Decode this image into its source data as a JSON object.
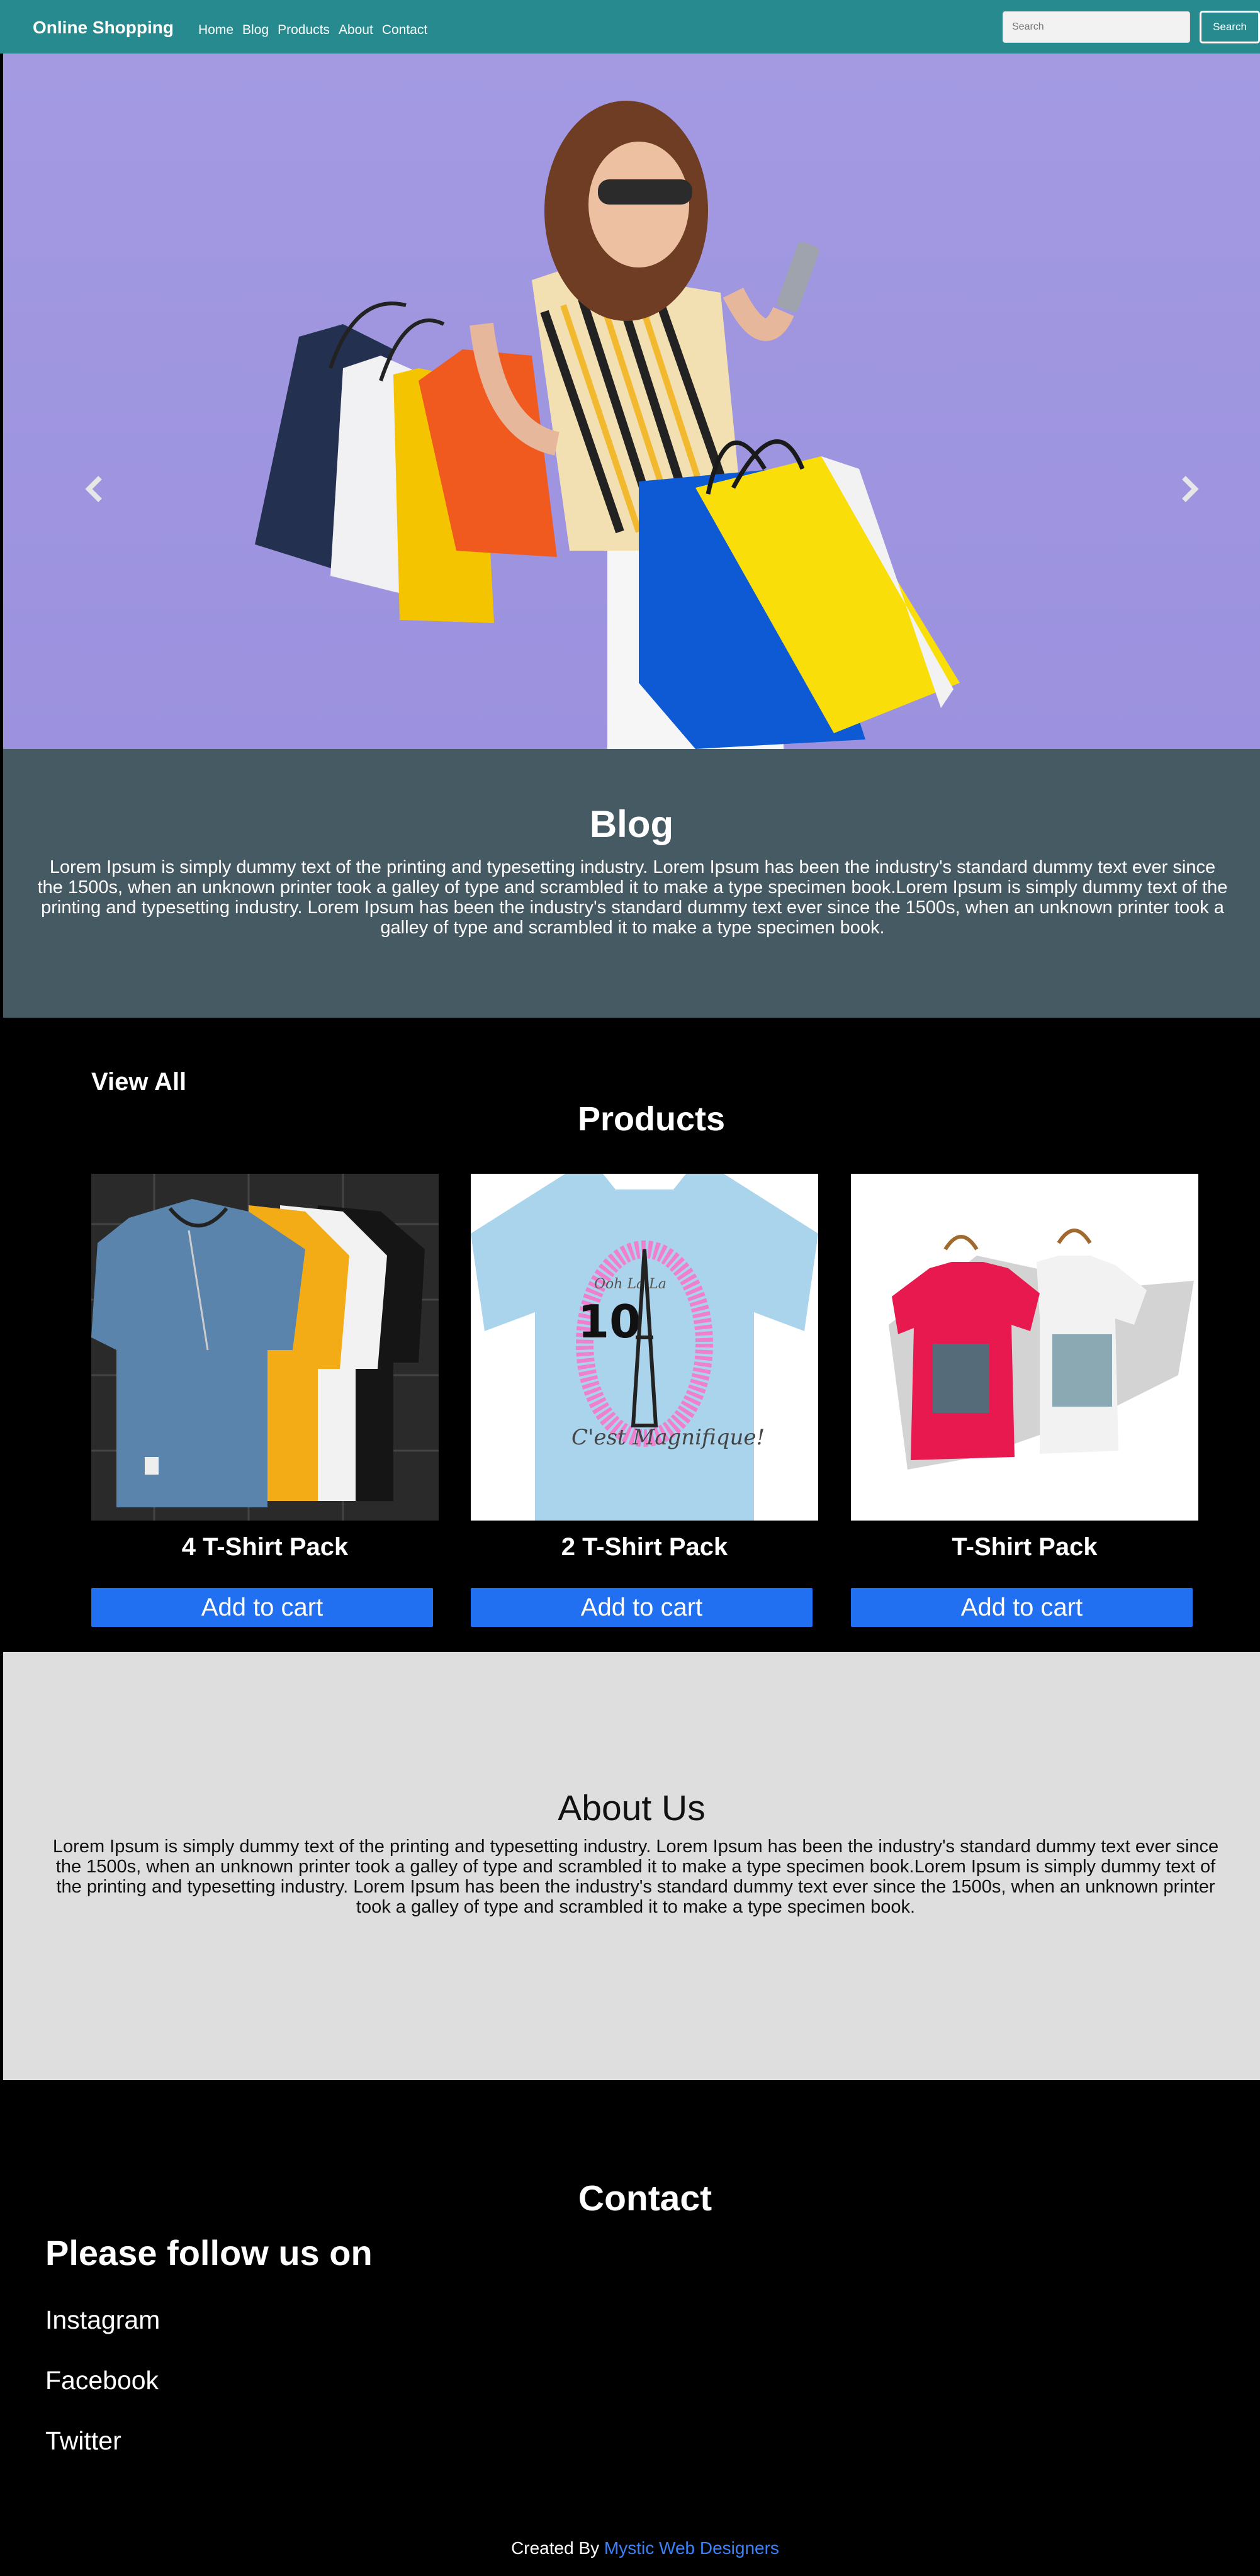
{
  "navbar": {
    "brand": "Online Shopping",
    "links": [
      "Home",
      "Blog",
      "Products",
      "About",
      "Contact"
    ],
    "search_placeholder": "Search",
    "search_button": "Search"
  },
  "hero": {
    "prev_icon": "chevron-left-icon",
    "next_icon": "chevron-right-icon",
    "slide_count": 3
  },
  "blog": {
    "title": "Blog",
    "text": "Lorem Ipsum is simply dummy text of the printing and typesetting industry. Lorem Ipsum has been the industry's standard dummy text ever since the 1500s, when an unknown printer took a galley of type and scrambled it to make a type specimen book.Lorem Ipsum is simply dummy text of the printing and typesetting industry. Lorem Ipsum has been the industry's standard dummy text ever since the 1500s, when an unknown printer took a galley of type and scrambled it to make a type specimen book."
  },
  "products": {
    "view_all": "View All",
    "title": "Products",
    "items": [
      {
        "name": "4 T-Shirt Pack",
        "button": "Add to cart"
      },
      {
        "name": "2 T-Shirt Pack",
        "button": "Add to cart"
      },
      {
        "name": "T-Shirt Pack",
        "button": "Add to cart"
      }
    ],
    "shirt2_text_top": "Ooh La La",
    "shirt2_number": "10",
    "shirt2_text_bottom": "C'est Magnifique!"
  },
  "about": {
    "title": "About Us",
    "text": "Lorem Ipsum is simply dummy text of the printing and typesetting industry. Lorem Ipsum has been the industry's standard dummy text ever since the 1500s, when an unknown printer took a galley of type and scrambled it to make a type specimen book.Lorem Ipsum is simply dummy text of the printing and typesetting industry. Lorem Ipsum has been the industry's standard dummy text ever since the 1500s, when an unknown printer took a galley of type and scrambled it to make a type specimen book."
  },
  "contact": {
    "title": "Contact",
    "follow": "Please follow us on",
    "links": [
      "Instagram",
      "Facebook",
      "Twitter"
    ],
    "footer_prefix": "Created By ",
    "footer_link": "Mystic Web Designers"
  },
  "colors": {
    "navbar": "#268a8f",
    "hero_bg": "#a39ae2",
    "blog_bg": "#465a64",
    "button": "#2170f2",
    "about_bg": "#dedede",
    "link": "#3b82f6"
  }
}
